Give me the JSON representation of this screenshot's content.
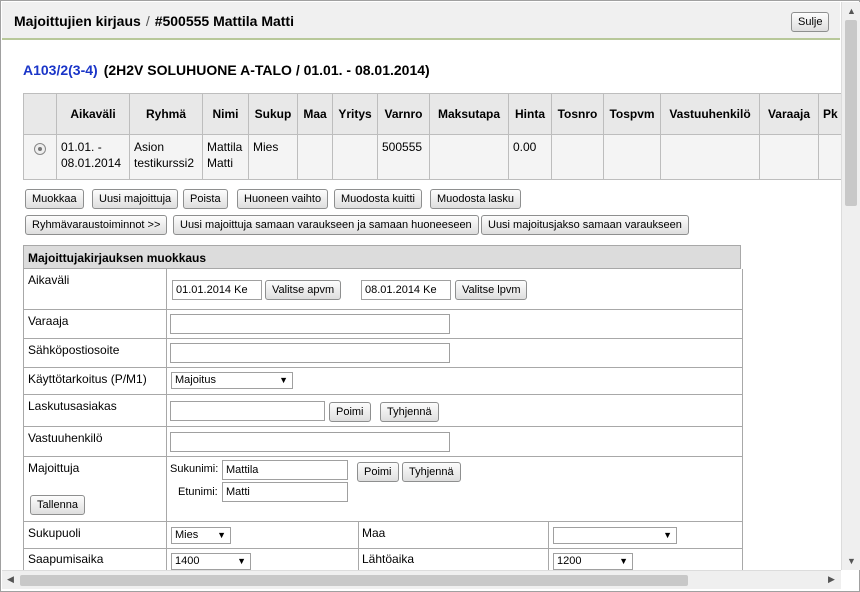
{
  "window": {
    "title_main": "Majoittujien kirjaus",
    "title_separator": "/",
    "title_record": "#500555 Mattila Matti",
    "close_label": "Sulje"
  },
  "heading": {
    "room_link": "A103/2(3-4)",
    "room_desc": "(2H2V SOLUHUONE A-TALO / 01.01. - 08.01.2014)"
  },
  "table": {
    "headers": [
      "",
      "Aikaväli",
      "Ryhmä",
      "Nimi",
      "Sukup",
      "Maa",
      "Yritys",
      "Varnro",
      "Maksutapa",
      "Hinta",
      "Tosnro",
      "Tospvm",
      "Vastuuhenkilö",
      "Varaaja",
      "Pk"
    ],
    "row": {
      "aikavali_1": "01.01. -",
      "aikavali_2": "08.01.2014",
      "ryhma_1": "Asion",
      "ryhma_2": "testikurssi2",
      "nimi_1": "Mattila",
      "nimi_2": "Matti",
      "sukup": "Mies",
      "maa": "",
      "yritys": "",
      "varnro": "500555",
      "maksutapa": "",
      "hinta": "0.00",
      "tosnro": "",
      "tospvm": "",
      "vastuuhenkilo": "",
      "varaaja": "",
      "pk": ""
    }
  },
  "actions": {
    "muokkaa": "Muokkaa",
    "uusi_majoittuja": "Uusi majoittuja",
    "poista": "Poista",
    "huoneen_vaihto": "Huoneen vaihto",
    "muodosta_kuitti": "Muodosta kuitti",
    "muodosta_lasku": "Muodosta lasku",
    "ryhmavaraus": "Ryhmävaraustoiminnot >>",
    "uusi_samaan": "Uusi majoittuja samaan varaukseen ja samaan huoneeseen",
    "uusi_jakso": "Uusi majoitusjakso samaan varaukseen"
  },
  "form": {
    "title": "Majoittujakirjauksen muokkaus",
    "aikavali_label": "Aikaväli",
    "start_date": "01.01.2014 Ke",
    "choose_start": "Valitse apvm",
    "end_date": "08.01.2014 Ke",
    "choose_end": "Valitse lpvm",
    "varaaja_label": "Varaaja",
    "varaaja_value": "",
    "email_label": "Sähköpostiosoite",
    "email_value": "",
    "purpose_label": "Käyttötarkoitus (P/M1)",
    "purpose_value": "Majoitus",
    "billing_label": "Laskutusasiakas",
    "billing_value": "",
    "pick_label": "Poimi",
    "clear_label": "Tyhjennä",
    "responsible_label": "Vastuuhenkilö",
    "responsible_value": "",
    "guest_label": "Majoittuja",
    "surname_label": "Sukunimi:",
    "surname_value": "Mattila",
    "firstname_label": "Etunimi:",
    "firstname_value": "Matti",
    "save_label": "Tallenna",
    "gender_label": "Sukupuoli",
    "gender_value": "Mies",
    "country_label": "Maa",
    "country_value": "",
    "arrival_label": "Saapumisaika",
    "arrival_value": "1400",
    "departure_label": "Lähtöaika",
    "departure_value": "1200"
  }
}
